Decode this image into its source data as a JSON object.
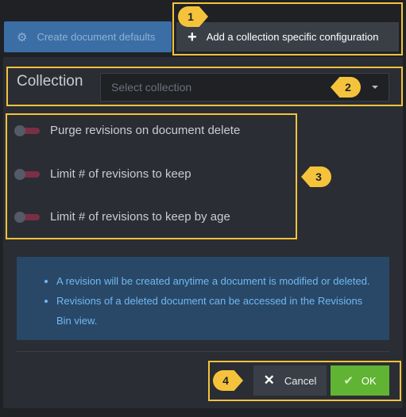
{
  "toolbar": {
    "defaults_button": {
      "label": "Create document defaults",
      "icon": "gear-icon"
    },
    "add_button": {
      "label": "Add a collection specific configuration",
      "icon": "plus-icon"
    }
  },
  "collection": {
    "label": "Collection",
    "placeholder": "Select collection"
  },
  "toggles": [
    {
      "label": "Purge revisions on document delete",
      "on": false
    },
    {
      "label": "Limit # of revisions to keep",
      "on": false
    },
    {
      "label": "Limit # of revisions to keep by age",
      "on": false
    }
  ],
  "info": {
    "items": [
      "A revision will be created anytime a document is modified or deleted.",
      "Revisions of a deleted document can be accessed in the Revisions Bin view."
    ]
  },
  "footer": {
    "cancel_label": "Cancel",
    "ok_label": "OK"
  },
  "callouts": [
    "1",
    "2",
    "3",
    "4"
  ],
  "colors": {
    "highlight": "#f5c33b",
    "primary": "#3a6ea5",
    "success": "#61b334",
    "toggle_track": "#7a2f45"
  }
}
